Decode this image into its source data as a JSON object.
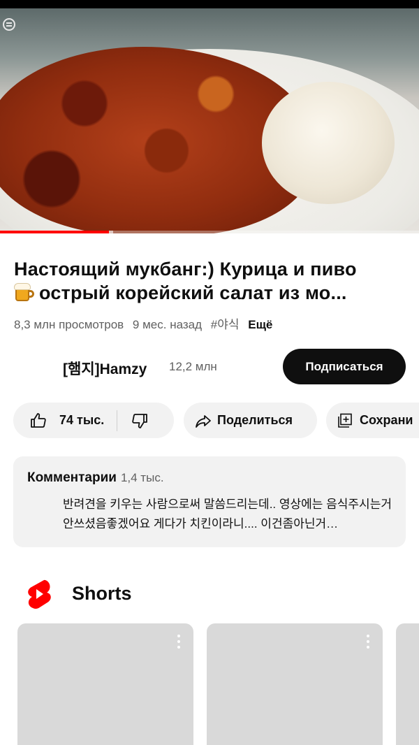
{
  "video": {
    "progress_fraction": 0.26,
    "buffer_fraction": 0.27
  },
  "title": {
    "line1": "Настоящий мукбанг:) Курица и пиво",
    "line2": "острый корейский салат из мо..."
  },
  "meta": {
    "views": "8,3 млн просмотров",
    "age": "9 мес. назад",
    "hashtag": "#야식",
    "more": "Ещё"
  },
  "channel": {
    "name": "[햄지]Hamzy",
    "subscribers": "12,2 млн",
    "subscribe_label": "Подписаться"
  },
  "actions": {
    "likes": "74 тыс.",
    "share_label": "Поделиться",
    "save_label": "Сохрани"
  },
  "comments": {
    "header": "Комментарии",
    "count": "1,4 тыс.",
    "top_comment": "반려견을 키우는 사람으로써 말씀드리는데.. 영상에는 음식주시는거 안쓰셨음좋겠어요 게다가 치킨이라니.... 이건좀아닌거…"
  },
  "shorts": {
    "title": "Shorts",
    "brand_color": "#ff0000"
  },
  "colors": {
    "accent": "#ff0000",
    "subscribe_bg": "#0f0f0f",
    "chip_bg": "#f2f2f2"
  }
}
